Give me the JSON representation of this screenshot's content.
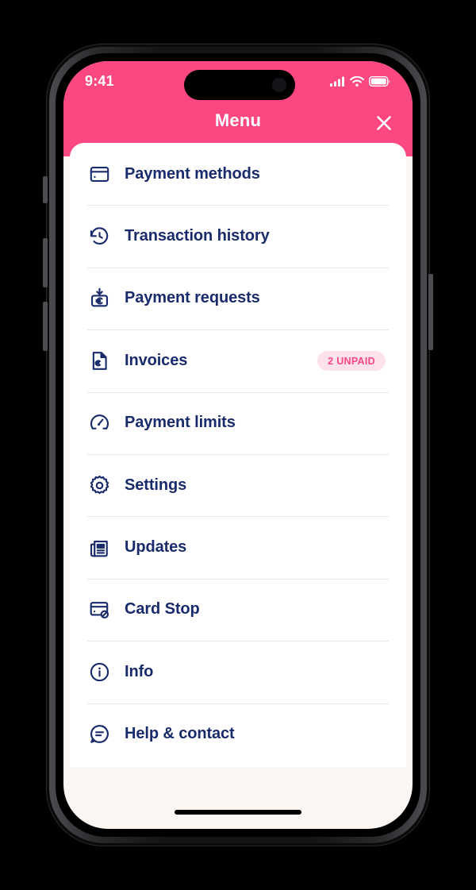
{
  "status_bar": {
    "time": "9:41",
    "signal_icon": "cellular-signal-icon",
    "wifi_icon": "wifi-icon",
    "battery_icon": "battery-full-icon"
  },
  "header": {
    "title": "Menu",
    "close_icon": "close-x-icon",
    "background_color": "#FC4780",
    "title_color": "#FFFFFF"
  },
  "theme": {
    "accent_pink": "#FC4780",
    "text_navy": "#1A2B6B",
    "card_white": "#FFFFFF",
    "page_background": "#FBF6F2",
    "divider": "#EDE7E1",
    "badge_background": "#FDE2EC"
  },
  "menu": {
    "items": [
      {
        "label": "Payment methods",
        "icon": "credit-card-icon",
        "badge": null
      },
      {
        "label": "Transaction history",
        "icon": "clock-rewind-icon",
        "badge": null
      },
      {
        "label": "Payment requests",
        "icon": "money-request-icon",
        "badge": null
      },
      {
        "label": "Invoices",
        "icon": "invoice-document-icon",
        "badge": "2 UNPAID"
      },
      {
        "label": "Payment limits",
        "icon": "speedometer-icon",
        "badge": null
      },
      {
        "label": "Settings",
        "icon": "gear-icon",
        "badge": null
      },
      {
        "label": "Updates",
        "icon": "newspaper-icon",
        "badge": null
      },
      {
        "label": "Card Stop",
        "icon": "card-block-icon",
        "badge": null
      },
      {
        "label": "Info",
        "icon": "info-circle-icon",
        "badge": null
      },
      {
        "label": "Help & contact",
        "icon": "chat-help-icon",
        "badge": null
      }
    ]
  },
  "device": {
    "home_indicator": "home-indicator"
  }
}
